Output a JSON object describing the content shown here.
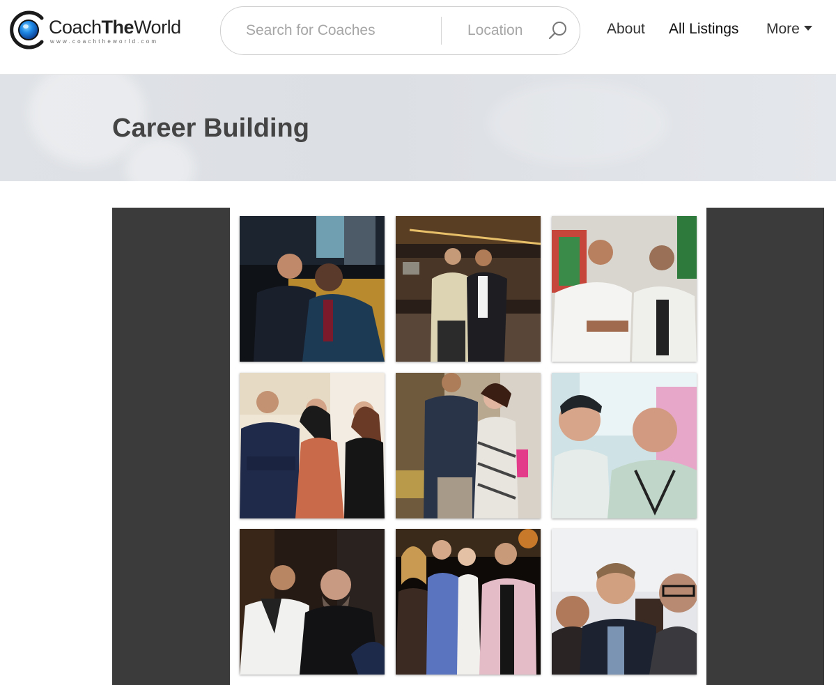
{
  "brand": {
    "name_prefix": "Coach",
    "name_bold": "The",
    "name_suffix": "World",
    "url": "www.coachtheworld.com"
  },
  "search": {
    "placeholder": "Search for Coaches",
    "location_placeholder": "Location",
    "icon": "search-icon"
  },
  "nav": {
    "about": "About",
    "all_listings": "All Listings",
    "more": "More",
    "more_icon": "caret-down-icon"
  },
  "page": {
    "title": "Career Building"
  },
  "colors": {
    "gallery_frame": "#3b3b3b",
    "banner": "#dfe2e6",
    "logo_blue": "#1e88e5"
  }
}
